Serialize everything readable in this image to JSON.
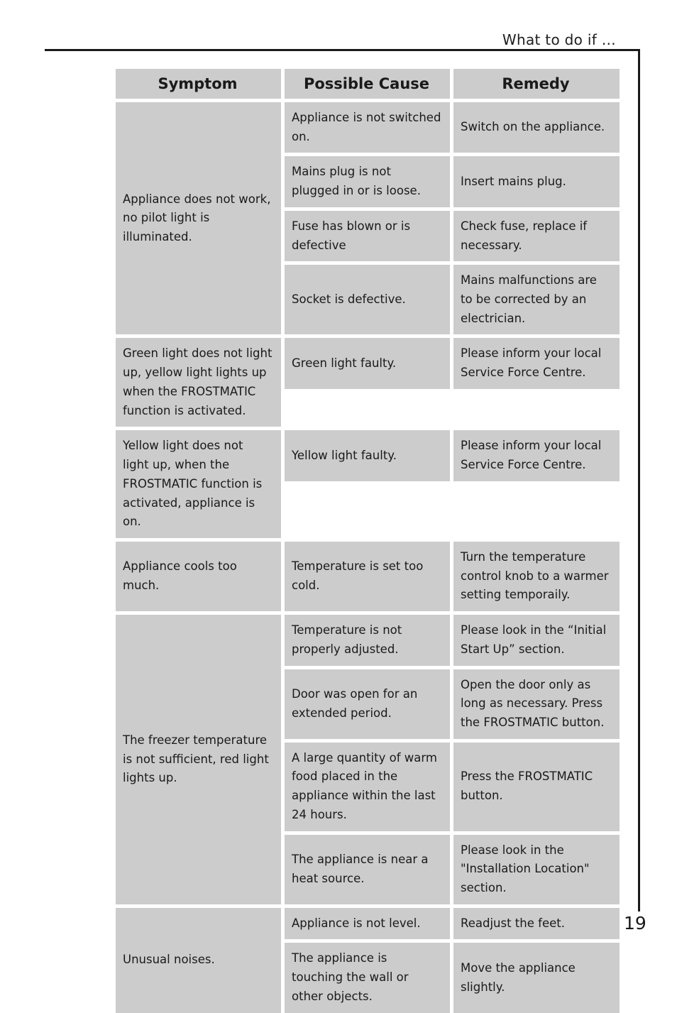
{
  "running_head": "What to do if …",
  "page_number": "19",
  "table": {
    "headers": {
      "symptom": "Symptom",
      "cause": "Possible Cause",
      "remedy": "Remedy"
    },
    "groups": [
      {
        "symptom": "Appliance does not work, no pilot light is illuminated.",
        "rows": [
          {
            "cause": "Appliance is not switched on.",
            "remedy": "Switch on the appliance."
          },
          {
            "cause": "Mains plug is not plugged in or is loose.",
            "remedy": "Insert mains plug."
          },
          {
            "cause": "Fuse has blown or is defective",
            "remedy": "Check fuse, replace if necessary."
          },
          {
            "cause": "Socket is defective.",
            "remedy": "Mains malfunctions are to be corrected by an electrician."
          }
        ]
      },
      {
        "symptom": "Green light does not light up, yellow light lights up when the FROSTMATIC function is activated.",
        "rows": [
          {
            "cause": "Green light faulty.",
            "remedy": "Please inform your local Service Force Centre."
          }
        ]
      },
      {
        "symptom": "Yellow light does not light up, when the FROSTMATIC function is activated, appliance is on.",
        "rows": [
          {
            "cause": "Yellow light faulty.",
            "remedy": "Please inform your local Service Force Centre."
          }
        ]
      },
      {
        "symptom": "Appliance cools too much.",
        "rows": [
          {
            "cause": "Temperature is set too cold.",
            "remedy": "Turn the temperature control knob to a warmer setting temporaily."
          }
        ]
      },
      {
        "symptom": "The freezer temperature is not sufficient, red light lights up.",
        "rows": [
          {
            "cause": "Temperature is not properly adjusted.",
            "remedy": "Please look in the “Initial Start Up” section."
          },
          {
            "cause": "Door was open for an extended period.",
            "remedy": "Open the door only as long as necessary. Press the FROSTMATIC button."
          },
          {
            "cause": "A large quantity of warm food placed in the appliance within the last 24 hours.",
            "remedy": "Press the FROSTMATIC button."
          },
          {
            "cause": "The appliance is near a heat source.",
            "remedy": "Please look in the \"Installation Location\" section."
          }
        ]
      },
      {
        "symptom": "Unusual noises.",
        "rows": [
          {
            "cause": "Appliance is not level.",
            "remedy": "Readjust the feet."
          },
          {
            "cause": "The appliance is touching the wall or other objects.",
            "remedy": "Move the appliance slightly."
          }
        ]
      }
    ]
  }
}
